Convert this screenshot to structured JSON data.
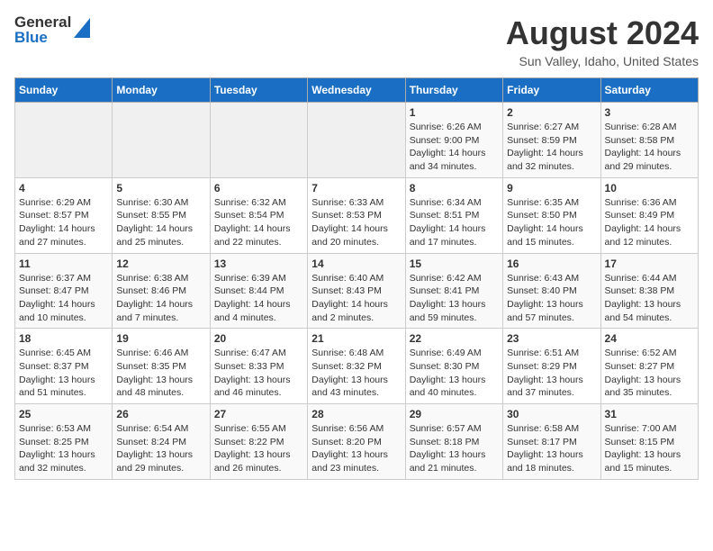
{
  "logo": {
    "line1": "General",
    "line2": "Blue"
  },
  "title": "August 2024",
  "subtitle": "Sun Valley, Idaho, United States",
  "days_of_week": [
    "Sunday",
    "Monday",
    "Tuesday",
    "Wednesday",
    "Thursday",
    "Friday",
    "Saturday"
  ],
  "weeks": [
    [
      {
        "day": "",
        "info": ""
      },
      {
        "day": "",
        "info": ""
      },
      {
        "day": "",
        "info": ""
      },
      {
        "day": "",
        "info": ""
      },
      {
        "day": "1",
        "info": "Sunrise: 6:26 AM\nSunset: 9:00 PM\nDaylight: 14 hours and 34 minutes."
      },
      {
        "day": "2",
        "info": "Sunrise: 6:27 AM\nSunset: 8:59 PM\nDaylight: 14 hours and 32 minutes."
      },
      {
        "day": "3",
        "info": "Sunrise: 6:28 AM\nSunset: 8:58 PM\nDaylight: 14 hours and 29 minutes."
      }
    ],
    [
      {
        "day": "4",
        "info": "Sunrise: 6:29 AM\nSunset: 8:57 PM\nDaylight: 14 hours and 27 minutes."
      },
      {
        "day": "5",
        "info": "Sunrise: 6:30 AM\nSunset: 8:55 PM\nDaylight: 14 hours and 25 minutes."
      },
      {
        "day": "6",
        "info": "Sunrise: 6:32 AM\nSunset: 8:54 PM\nDaylight: 14 hours and 22 minutes."
      },
      {
        "day": "7",
        "info": "Sunrise: 6:33 AM\nSunset: 8:53 PM\nDaylight: 14 hours and 20 minutes."
      },
      {
        "day": "8",
        "info": "Sunrise: 6:34 AM\nSunset: 8:51 PM\nDaylight: 14 hours and 17 minutes."
      },
      {
        "day": "9",
        "info": "Sunrise: 6:35 AM\nSunset: 8:50 PM\nDaylight: 14 hours and 15 minutes."
      },
      {
        "day": "10",
        "info": "Sunrise: 6:36 AM\nSunset: 8:49 PM\nDaylight: 14 hours and 12 minutes."
      }
    ],
    [
      {
        "day": "11",
        "info": "Sunrise: 6:37 AM\nSunset: 8:47 PM\nDaylight: 14 hours and 10 minutes."
      },
      {
        "day": "12",
        "info": "Sunrise: 6:38 AM\nSunset: 8:46 PM\nDaylight: 14 hours and 7 minutes."
      },
      {
        "day": "13",
        "info": "Sunrise: 6:39 AM\nSunset: 8:44 PM\nDaylight: 14 hours and 4 minutes."
      },
      {
        "day": "14",
        "info": "Sunrise: 6:40 AM\nSunset: 8:43 PM\nDaylight: 14 hours and 2 minutes."
      },
      {
        "day": "15",
        "info": "Sunrise: 6:42 AM\nSunset: 8:41 PM\nDaylight: 13 hours and 59 minutes."
      },
      {
        "day": "16",
        "info": "Sunrise: 6:43 AM\nSunset: 8:40 PM\nDaylight: 13 hours and 57 minutes."
      },
      {
        "day": "17",
        "info": "Sunrise: 6:44 AM\nSunset: 8:38 PM\nDaylight: 13 hours and 54 minutes."
      }
    ],
    [
      {
        "day": "18",
        "info": "Sunrise: 6:45 AM\nSunset: 8:37 PM\nDaylight: 13 hours and 51 minutes."
      },
      {
        "day": "19",
        "info": "Sunrise: 6:46 AM\nSunset: 8:35 PM\nDaylight: 13 hours and 48 minutes."
      },
      {
        "day": "20",
        "info": "Sunrise: 6:47 AM\nSunset: 8:33 PM\nDaylight: 13 hours and 46 minutes."
      },
      {
        "day": "21",
        "info": "Sunrise: 6:48 AM\nSunset: 8:32 PM\nDaylight: 13 hours and 43 minutes."
      },
      {
        "day": "22",
        "info": "Sunrise: 6:49 AM\nSunset: 8:30 PM\nDaylight: 13 hours and 40 minutes."
      },
      {
        "day": "23",
        "info": "Sunrise: 6:51 AM\nSunset: 8:29 PM\nDaylight: 13 hours and 37 minutes."
      },
      {
        "day": "24",
        "info": "Sunrise: 6:52 AM\nSunset: 8:27 PM\nDaylight: 13 hours and 35 minutes."
      }
    ],
    [
      {
        "day": "25",
        "info": "Sunrise: 6:53 AM\nSunset: 8:25 PM\nDaylight: 13 hours and 32 minutes."
      },
      {
        "day": "26",
        "info": "Sunrise: 6:54 AM\nSunset: 8:24 PM\nDaylight: 13 hours and 29 minutes."
      },
      {
        "day": "27",
        "info": "Sunrise: 6:55 AM\nSunset: 8:22 PM\nDaylight: 13 hours and 26 minutes."
      },
      {
        "day": "28",
        "info": "Sunrise: 6:56 AM\nSunset: 8:20 PM\nDaylight: 13 hours and 23 minutes."
      },
      {
        "day": "29",
        "info": "Sunrise: 6:57 AM\nSunset: 8:18 PM\nDaylight: 13 hours and 21 minutes."
      },
      {
        "day": "30",
        "info": "Sunrise: 6:58 AM\nSunset: 8:17 PM\nDaylight: 13 hours and 18 minutes."
      },
      {
        "day": "31",
        "info": "Sunrise: 7:00 AM\nSunset: 8:15 PM\nDaylight: 13 hours and 15 minutes."
      }
    ]
  ]
}
